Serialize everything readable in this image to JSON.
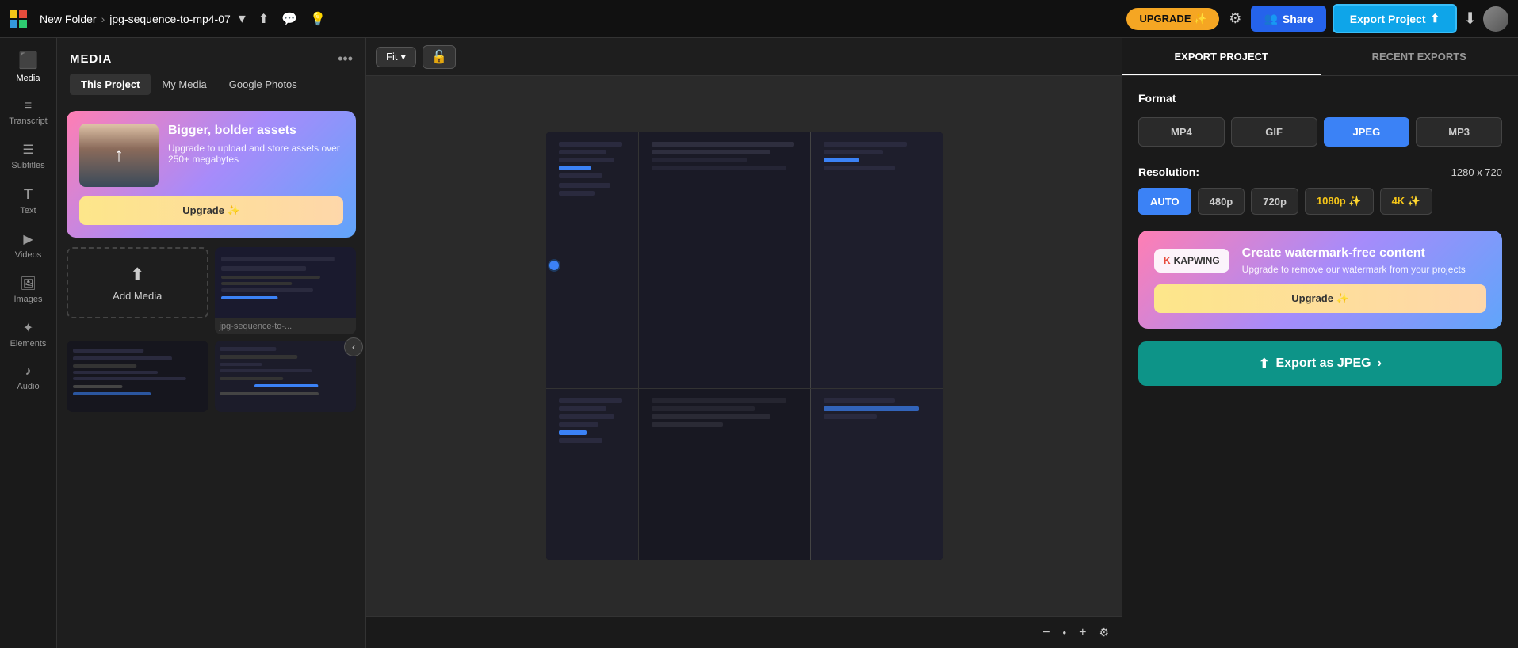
{
  "topbar": {
    "folder": "New Folder",
    "separator": "›",
    "project": "jpg-sequence-to-mp4-07",
    "upgrade_label": "UPGRADE ✨",
    "share_label": "Share",
    "export_project_label": "Export Project",
    "chevron_down": "▾"
  },
  "sidebar": {
    "items": [
      {
        "id": "media",
        "label": "Media",
        "icon": "⬛",
        "active": true
      },
      {
        "id": "transcript",
        "label": "Transcript",
        "icon": "≡",
        "active": false
      },
      {
        "id": "subtitles",
        "label": "Subtitles",
        "icon": "☰",
        "active": false
      },
      {
        "id": "text",
        "label": "Text",
        "icon": "T",
        "active": false
      },
      {
        "id": "videos",
        "label": "Videos",
        "icon": "▶",
        "active": false
      },
      {
        "id": "images",
        "label": "Images",
        "icon": "🖼",
        "active": false
      },
      {
        "id": "elements",
        "label": "Elements",
        "icon": "✦",
        "active": false
      },
      {
        "id": "audio",
        "label": "Audio",
        "icon": "♪",
        "active": false
      }
    ]
  },
  "media_panel": {
    "title": "MEDIA",
    "tabs": [
      {
        "label": "This Project",
        "active": true
      },
      {
        "label": "My Media",
        "active": false
      },
      {
        "label": "Google Photos",
        "active": false
      }
    ],
    "upgrade_card": {
      "heading": "Bigger, bolder assets",
      "body": "Upgrade to upload and store assets over 250+ megabytes",
      "button_label": "Upgrade ✨"
    },
    "add_media_label": "Add Media",
    "file_label": "jpg-sequence-to-..."
  },
  "canvas": {
    "fit_label": "Fit",
    "chevron": "▾"
  },
  "export_panel": {
    "tabs": [
      {
        "label": "EXPORT PROJECT",
        "active": true
      },
      {
        "label": "RECENT EXPORTS",
        "active": false
      }
    ],
    "format_section": "Format",
    "formats": [
      {
        "label": "MP4",
        "active": false
      },
      {
        "label": "GIF",
        "active": false
      },
      {
        "label": "JPEG",
        "active": true
      },
      {
        "label": "MP3",
        "active": false
      }
    ],
    "resolution_label": "Resolution:",
    "resolution_value": "1280 x 720",
    "resolutions": [
      {
        "label": "AUTO",
        "active": true
      },
      {
        "label": "480p",
        "active": false
      },
      {
        "label": "720p",
        "active": false
      },
      {
        "label": "1080p ✨",
        "active": false,
        "premium": true
      },
      {
        "label": "4K ✨",
        "active": false,
        "premium": true
      }
    ],
    "upgrade_card": {
      "logo_text": "KAPWING",
      "heading": "Create watermark-free content",
      "body": "Upgrade to remove our watermark from your projects",
      "button_label": "Upgrade ✨"
    },
    "export_button_label": "Export as JPEG",
    "export_icon": "⬆"
  },
  "bottom": {
    "zoom_minus": "−",
    "zoom_dot": "•",
    "zoom_plus": "+",
    "zoom_settings": "⚙"
  }
}
